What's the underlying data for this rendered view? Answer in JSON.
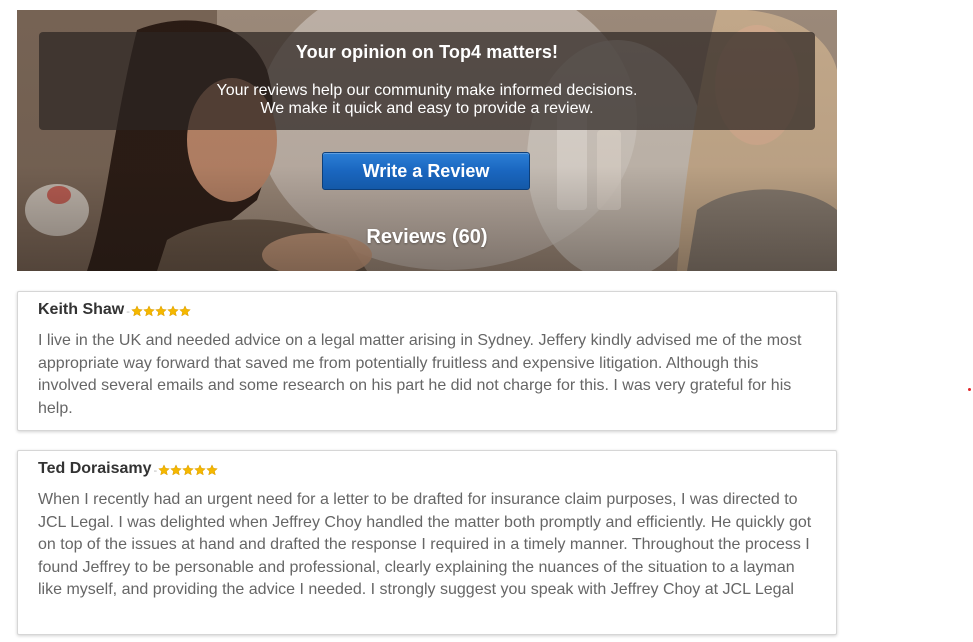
{
  "hero": {
    "title": "Your opinion on Top4 matters!",
    "line1": "Your reviews help our community make informed decisions.",
    "line2": "We make it quick and easy to provide a review.",
    "button_label": "Write a Review",
    "reviews_count": "Reviews (60)"
  },
  "reviews": [
    {
      "name": "Keith Shaw",
      "separator": "-",
      "rating": 5,
      "text": "I live in the UK and needed advice on a legal matter arising in Sydney. Jeffery kindly advised me of the most appropriate way forward that saved me from potentially fruitless and expensive litigation. Although this involved several emails and some research on his part he did not charge for this. I was very grateful for his help."
    },
    {
      "name": "Ted Doraisamy",
      "separator": "-",
      "rating": 5,
      "text": "When I recently had an urgent need for a letter to be drafted for insurance claim purposes, I was directed to JCL Legal. I was delighted when Jeffrey Choy handled the matter both promptly and efficiently. He quickly got on top of the issues at hand and drafted the response I required in a timely manner. Throughout the process I found Jeffrey to be personable and professional, clearly explaining the nuances of the situation to a layman like myself, and providing the advice I needed. I strongly suggest you speak with Jeffrey Choy at JCL Legal"
    }
  ],
  "colors": {
    "button_blue": "#1a66bf",
    "star_gold": "#f5b800",
    "body_text": "#666666",
    "name_text": "#333333"
  },
  "icons": {
    "star": "star-icon"
  }
}
